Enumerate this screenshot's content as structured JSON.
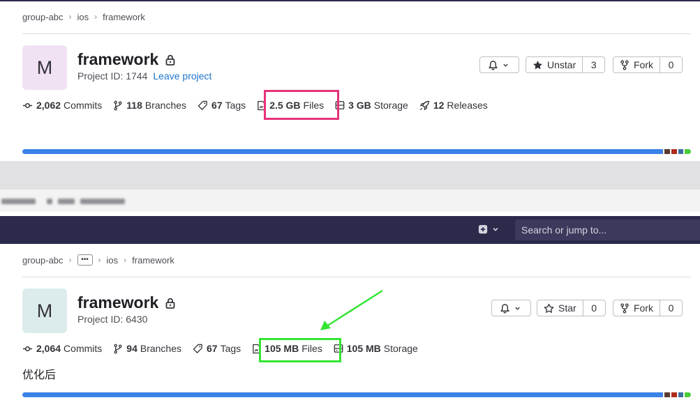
{
  "top_panel": {
    "breadcrumb": [
      "group-abc",
      "ios",
      "framework"
    ],
    "avatar_letter": "M",
    "project_name": "framework",
    "project_id": "Project ID: 1744",
    "leave_link": "Leave project",
    "star_label": "Unstar",
    "star_count": "3",
    "fork_label": "Fork",
    "fork_count": "0",
    "stats": {
      "commits_value": "2,062",
      "commits_label": "Commits",
      "branches_value": "118",
      "branches_label": "Branches",
      "tags_value": "67",
      "tags_label": "Tags",
      "files_value": "2.5 GB",
      "files_label": "Files",
      "storage_value": "3 GB",
      "storage_label": "Storage",
      "releases_value": "12",
      "releases_label": "Releases"
    }
  },
  "navbar": {
    "search_placeholder": "Search or jump to..."
  },
  "bottom_panel": {
    "breadcrumb": [
      "group-abc",
      "ios",
      "framework"
    ],
    "avatar_letter": "M",
    "project_name": "framework",
    "project_id": "Project ID: 6430",
    "star_label": "Star",
    "star_count": "0",
    "fork_label": "Fork",
    "fork_count": "0",
    "stats": {
      "commits_value": "2,064",
      "commits_label": "Commits",
      "branches_value": "94",
      "branches_label": "Branches",
      "tags_value": "67",
      "tags_label": "Tags",
      "files_value": "105 MB",
      "files_label": "Files",
      "storage_value": "105 MB",
      "storage_label": "Storage"
    },
    "annotation": "优化后"
  },
  "colors": {
    "language_bar_main": "#3b82e8",
    "highlight_before": "#e8327a",
    "highlight_after": "#34e534",
    "navbar": "#2b2a4a",
    "link": "#1f75cb"
  }
}
